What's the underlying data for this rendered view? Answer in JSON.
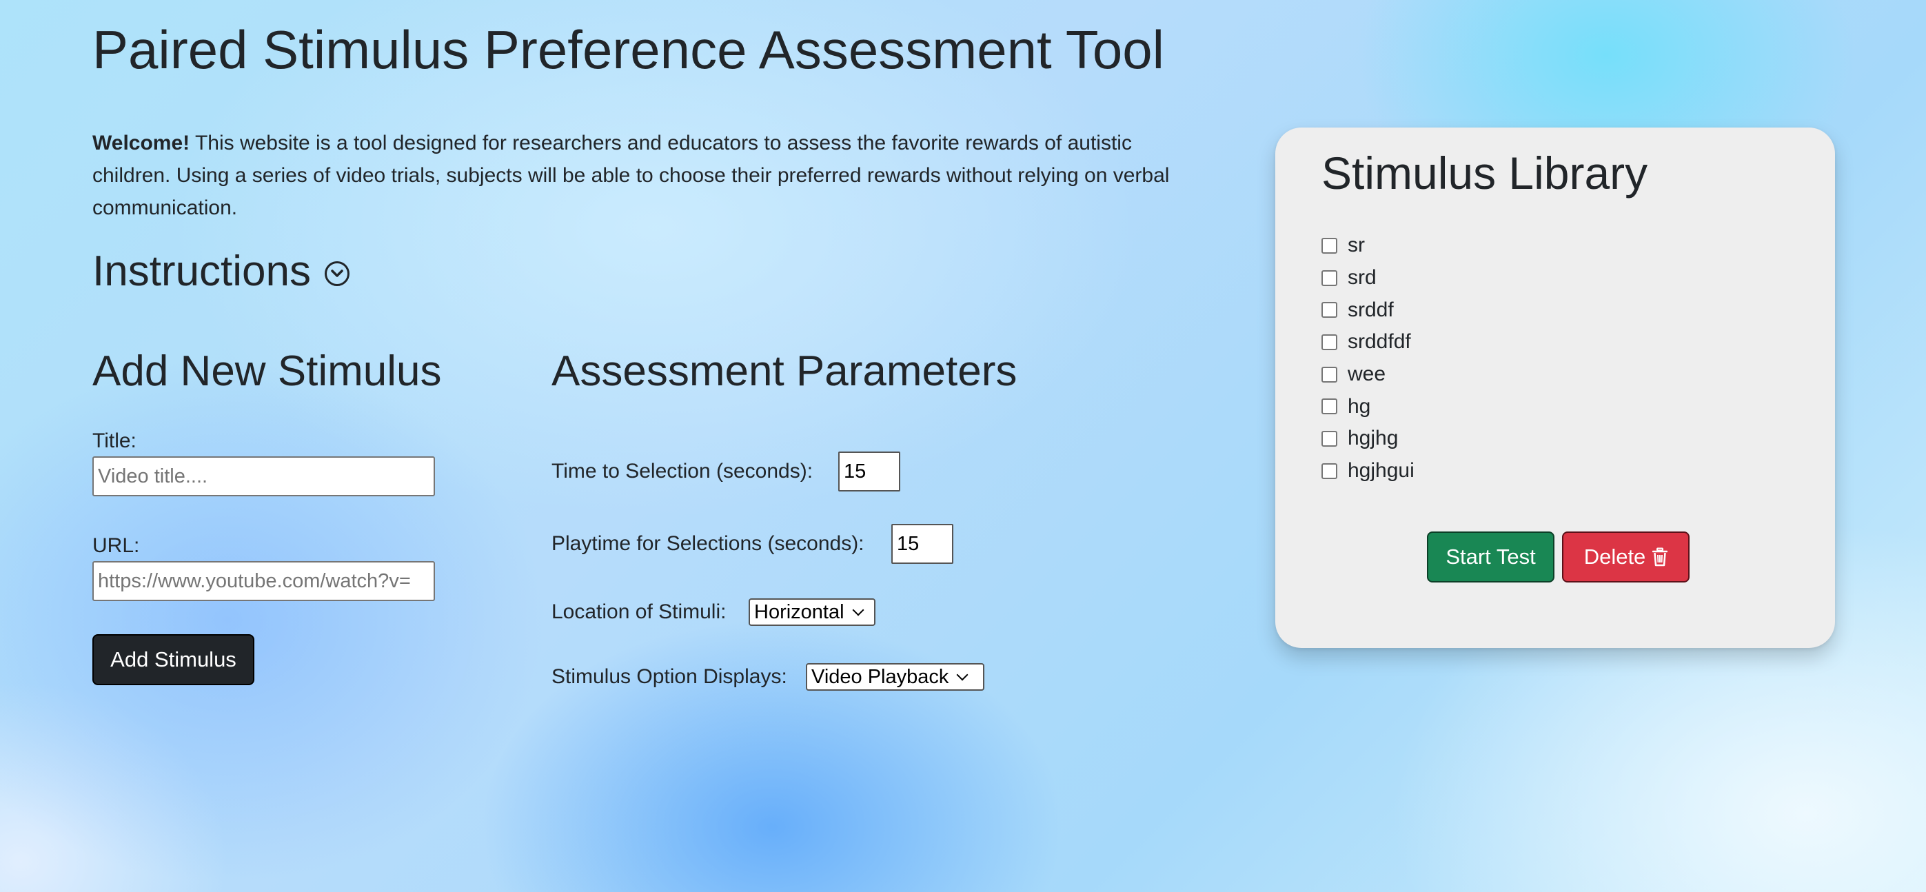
{
  "header": {
    "title": "Paired Stimulus Preference Assessment Tool"
  },
  "intro": {
    "welcome": "Welcome!",
    "text": " This website is a tool designed for researchers and educators to assess the favorite rewards of autistic children. Using a series of video trials, subjects will be able to choose their preferred rewards without relying on verbal communication."
  },
  "instructions": {
    "label": "Instructions",
    "icon": "chevron-down-circle-icon"
  },
  "add_stimulus": {
    "heading": "Add New Stimulus",
    "title_label": "Title:",
    "title_placeholder": "Video title....",
    "url_label": "URL:",
    "url_placeholder": "https://www.youtube.com/watch?v=",
    "button_label": "Add Stimulus"
  },
  "parameters": {
    "heading": "Assessment Parameters",
    "time_to_selection_label": "Time to Selection (seconds):",
    "time_to_selection_value": "15",
    "playtime_label": "Playtime for Selections (seconds):",
    "playtime_value": "15",
    "location_label": "Location of Stimuli:",
    "location_value": "Horizontal",
    "display_label": "Stimulus Option Displays:",
    "display_value": "Video Playback"
  },
  "library": {
    "heading": "Stimulus Library",
    "items": [
      {
        "label": "sr",
        "checked": false
      },
      {
        "label": "srd",
        "checked": false
      },
      {
        "label": "srddf",
        "checked": false
      },
      {
        "label": "srddfdf",
        "checked": false
      },
      {
        "label": "wee",
        "checked": false
      },
      {
        "label": "hg",
        "checked": false
      },
      {
        "label": "hgjhg",
        "checked": false
      },
      {
        "label": "hgjhgui",
        "checked": false
      }
    ],
    "start_label": "Start Test",
    "delete_label": "Delete",
    "delete_icon": "trash-icon"
  },
  "colors": {
    "start_button": "#198754",
    "delete_button": "#dc3545",
    "dark_button": "#212529",
    "card_background": "#eeeeee"
  }
}
